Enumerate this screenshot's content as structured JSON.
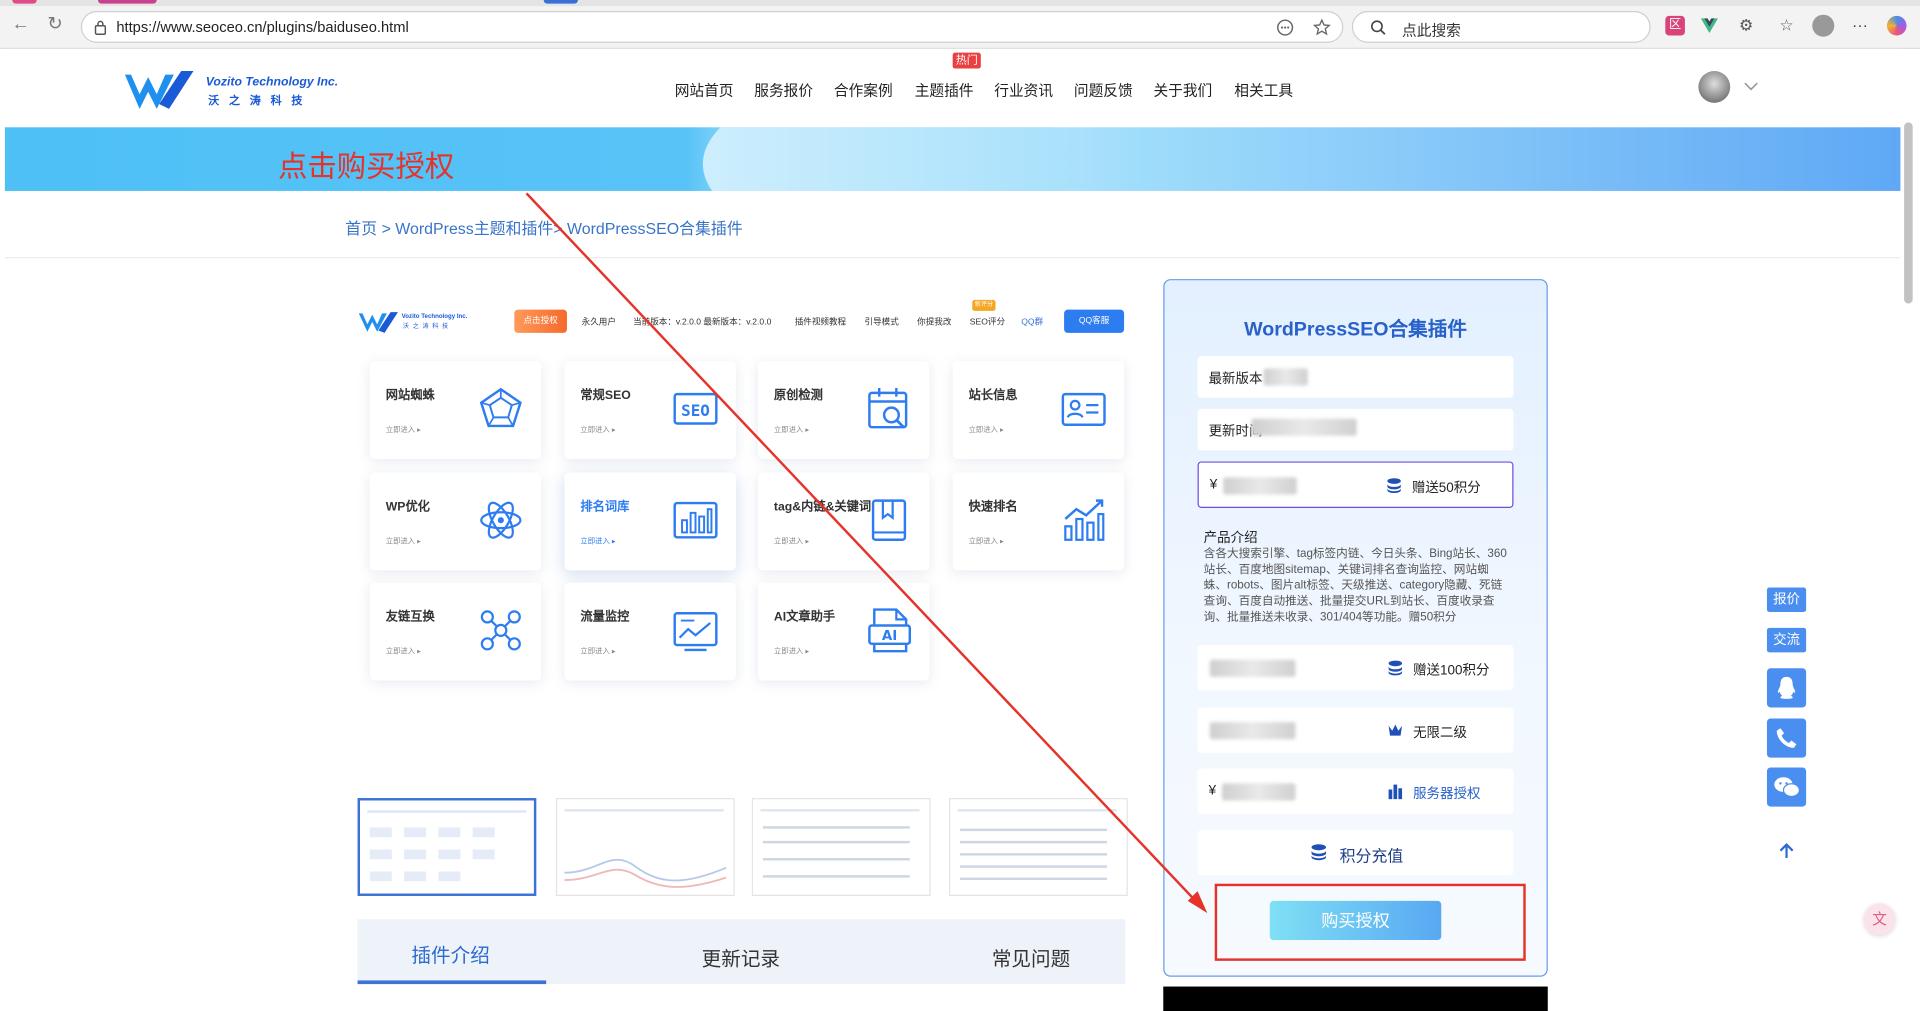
{
  "browser": {
    "url": "https://www.seoceo.cn/plugins/baiduseo.html",
    "search_placeholder": "点此搜索"
  },
  "site": {
    "logo_en": "Vozito Technology Inc.",
    "logo_cn": "沃之涛科技",
    "nav": [
      "网站首页",
      "服务报价",
      "合作案例",
      "主题插件",
      "行业资讯",
      "问题反馈",
      "关于我们",
      "相关工具"
    ],
    "hot_badge": "热门"
  },
  "banner": {
    "annotation": "点击购买授权"
  },
  "breadcrumb": "首页 > WordPress主题和插件> WordPressSEO合集插件",
  "preview": {
    "auth_btn": "点击授权",
    "user": "永久用户",
    "version": "当前版本：v.2.0.0  最新版本：v.2.0.0",
    "video": "插件视频教程",
    "guide": "引导模式",
    "wish": "你提我改",
    "score_badge": "新评分",
    "score": "SEO评分",
    "qq_group": "QQ群",
    "qq_service": "QQ客服",
    "enter": "立即进入 ▸",
    "cards": [
      {
        "title": "网站蜘蛛",
        "icon": "spider-pentagon-icon"
      },
      {
        "title": "常规SEO",
        "icon": "seo-icon"
      },
      {
        "title": "原创检测",
        "icon": "calendar-search-icon"
      },
      {
        "title": "站长信息",
        "icon": "id-card-icon"
      },
      {
        "title": "WP优化",
        "icon": "atom-icon"
      },
      {
        "title": "排名词库",
        "icon": "bar-chart-icon"
      },
      {
        "title": "tag&内链&关键词",
        "icon": "book-icon"
      },
      {
        "title": "快速排名",
        "icon": "trend-chart-icon"
      },
      {
        "title": "友链互换",
        "icon": "network-icon"
      },
      {
        "title": "流量监控",
        "icon": "monitor-chart-icon"
      },
      {
        "title": "AI文章助手",
        "icon": "ai-doc-icon"
      }
    ],
    "tabs": [
      "插件介绍",
      "更新记录",
      "常见问题"
    ]
  },
  "panel": {
    "title": "WordPressSEO合集插件",
    "latest_version_label": "最新版本",
    "update_time_label": "更新时间",
    "price_sign": "¥",
    "gift50": "赠送50积分",
    "intro_heading": "产品介绍",
    "intro_text": "含各大搜索引擎、tag标签内链、今日头条、Bing站长、360站长、百度地图sitemap、关键词排名查询监控、网站蜘蛛、robots、图片alt标签、天级推送、category隐藏、死链查询、百度自动推送、批量提交URL到站长、百度收录查询、批量推送未收录、301/404等功能。赠50积分",
    "gift100": "赠送100积分",
    "unlimited": "无限二级",
    "server_auth": "服务器授权",
    "recharge": "积分充值",
    "buy": "购买授权"
  },
  "float": {
    "quote": "报价",
    "chat": "交流"
  },
  "colors": {
    "brand_blue": "#2761c9",
    "annotation_red": "#e5332a"
  }
}
